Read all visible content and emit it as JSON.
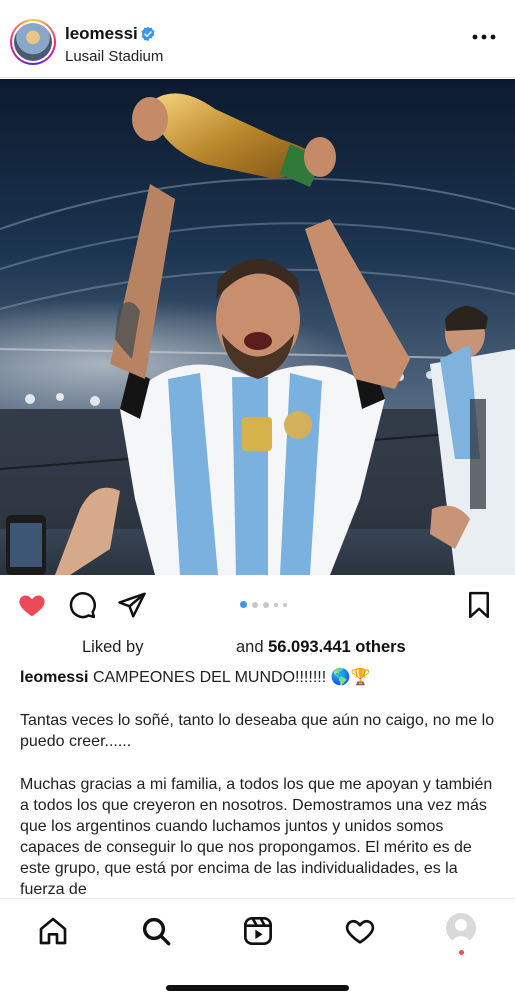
{
  "post": {
    "username": "leomessi",
    "location": "Lusail Stadium",
    "carousel": {
      "count": 5,
      "active_index": 0
    }
  },
  "likes": {
    "liked_by": "Liked by",
    "and_text": "and",
    "count_text": "56.093.441 others"
  },
  "caption": {
    "username": "leomessi",
    "headline": "CAMPEONES DEL MUNDO!!!!!!! 🌎🏆",
    "paragraph1": "Tantas veces lo soñé, tanto lo deseaba que aún no caigo, no me lo puedo creer......",
    "paragraph2": "Muchas gracias a mi familia, a todos los que me apoyan y también a todos los que creyeron en nosotros. Demostramos una vez más que los argentinos cuando luchamos juntos y unidos somos capaces de conseguir lo que nos propongamos. El mérito es de este grupo, que está por encima de las individualidades, es la fuerza de"
  },
  "colors": {
    "like_red": "#ed4956",
    "carousel_active": "#3897f0",
    "verified_blue": "#3897f0"
  },
  "icons": {
    "header": [
      "verified-badge-icon",
      "more-options-icon"
    ],
    "actions": [
      "heart-filled-icon",
      "comment-icon",
      "share-icon",
      "bookmark-icon"
    ],
    "tabs": [
      "home-icon",
      "search-icon",
      "reels-icon",
      "activity-heart-icon",
      "profile-avatar-icon"
    ]
  }
}
